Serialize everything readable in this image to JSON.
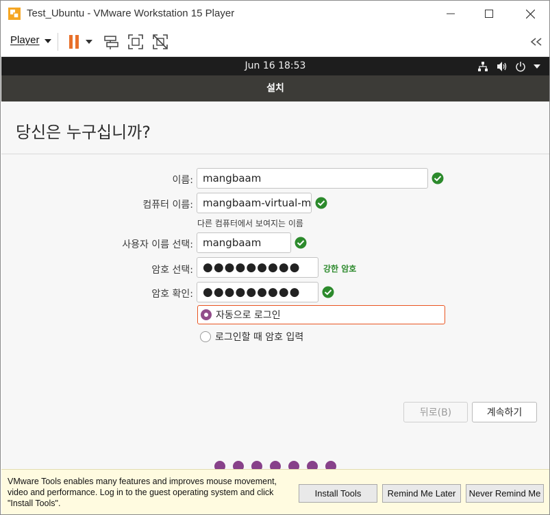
{
  "window": {
    "title": "Test_Ubuntu - VMware Workstation 15 Player"
  },
  "toolbar": {
    "player_menu": "Player",
    "icons": [
      "pause-icon",
      "dropdown-caret-icon",
      "send-ctrl-alt-del-icon",
      "fullscreen-icon",
      "unity-mode-icon",
      "collapse-toolbar-icon"
    ]
  },
  "panel": {
    "clock": "Jun 16  18:53",
    "icons": [
      "network-icon",
      "volume-icon",
      "power-icon",
      "panel-menu-caret-icon"
    ]
  },
  "installer": {
    "header": "설치",
    "title": "당신은 누구십니까?",
    "fields": {
      "name": {
        "label": "이름:",
        "value": "mangbaam"
      },
      "computer": {
        "label": "컴퓨터 이름:",
        "value": "mangbaam-virtual-mac",
        "hint": "다른 컴퓨터에서 보여지는 이름"
      },
      "username": {
        "label": "사용자 이름 선택:",
        "value": "mangbaam"
      },
      "password": {
        "label": "암호 선택:",
        "value": "●●●●●●●●●",
        "strength": "강한 암호"
      },
      "confirm": {
        "label": "암호 확인:",
        "value": "●●●●●●●●●"
      }
    },
    "login_options": {
      "auto_login": "자동으로 로그인",
      "require_password": "로그인할 때 암호 입력",
      "selected": "auto_login"
    },
    "buttons": {
      "back": "뒤로(B)",
      "continue": "계속하기"
    },
    "progress_steps_visible": 7
  },
  "banner": {
    "message": "VMware Tools enables many features and improves mouse movement, video and performance. Log in to the guest operating system and click \"Install Tools\".",
    "install": "Install Tools",
    "remind_later": "Remind Me Later",
    "never_remind": "Never Remind Me"
  },
  "colors": {
    "ubuntu_purple": "#924d8b",
    "ubuntu_orange": "#e95420",
    "valid_green": "#2c8a2c",
    "panel_dark": "#1d1d1d",
    "header_dark": "#3c3b37",
    "pause_orange": "#e8702a"
  }
}
